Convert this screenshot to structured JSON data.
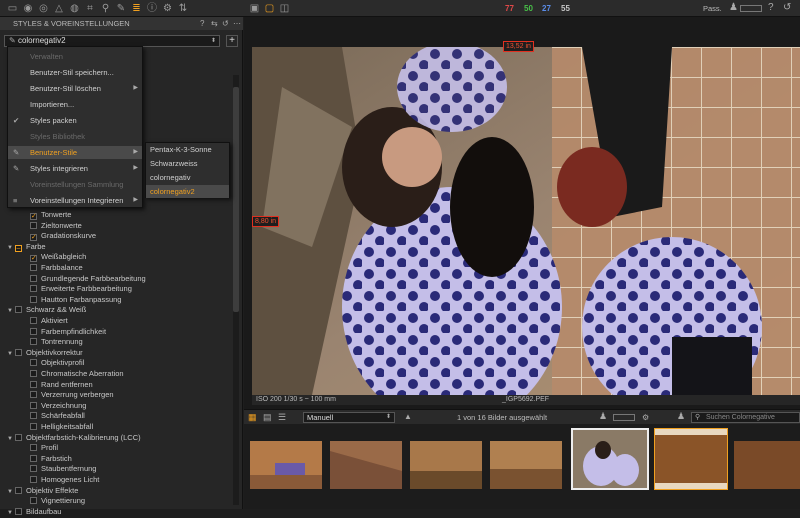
{
  "toolbar": {
    "icons": [
      "library-icon",
      "camera-icon",
      "color-icon",
      "exposure-icon",
      "lens-icon",
      "crop-icon",
      "search-icon",
      "brush-icon",
      "styles-icon",
      "info-icon",
      "gear-icon",
      "adjust-icon"
    ],
    "counts": [
      {
        "value": "77",
        "color": "#e04848"
      },
      {
        "value": "50",
        "color": "#48c048"
      },
      {
        "value": "27",
        "color": "#5a8ce8"
      },
      {
        "value": "55",
        "color": "#c8c8c8"
      }
    ],
    "pass_label": "Pass."
  },
  "panel": {
    "title": "STYLES & VOREINSTELLUNGEN",
    "selected_style": "colornegativ2",
    "add_label": "+"
  },
  "menu": {
    "items": [
      {
        "label": "Verwalten",
        "type": "header"
      },
      {
        "label": "Benutzer-Stil speichern...",
        "type": "item"
      },
      {
        "label": "Benutzer-Stil löschen",
        "type": "submenu"
      },
      {
        "label": "Importieren...",
        "type": "item"
      },
      {
        "label": "Styles packen",
        "type": "check"
      },
      {
        "label": "Styles Bibliothek",
        "type": "header"
      },
      {
        "label": "Benutzer-Stile",
        "type": "submenu-active"
      },
      {
        "label": "Styles integrieren",
        "type": "submenu"
      },
      {
        "label": "Voreinstellungen Sammlung",
        "type": "header"
      },
      {
        "label": "Voreinstellungen Integrieren",
        "type": "submenu"
      }
    ]
  },
  "submenu": {
    "items": [
      "Pentax-K-3-Sonne",
      "Schwarzweiss",
      "colornegativ",
      "colornegativ2"
    ],
    "selected": "colornegativ2"
  },
  "tree": [
    {
      "label": "Tonwerte",
      "level": 2,
      "checked": true
    },
    {
      "label": "Zieltonwerte",
      "level": 2,
      "checked": false
    },
    {
      "label": "Gradationskurve",
      "level": 2,
      "checked": true
    },
    {
      "label": "Farbe",
      "level": 1,
      "checked": false,
      "group": true
    },
    {
      "label": "Weißabgleich",
      "level": 2,
      "checked": true
    },
    {
      "label": "Farbbalance",
      "level": 2,
      "checked": false
    },
    {
      "label": "Grundlegende Farbbearbeitung",
      "level": 2,
      "checked": false
    },
    {
      "label": "Erweiterte Farbbearbeitung",
      "level": 2,
      "checked": false
    },
    {
      "label": "Hautton Farbanpassung",
      "level": 2,
      "checked": false
    },
    {
      "label": "Schwarz && Weiß",
      "level": 1,
      "checked": false,
      "group": true
    },
    {
      "label": "Aktiviert",
      "level": 2,
      "checked": false
    },
    {
      "label": "Farbempfindlichkeit",
      "level": 2,
      "checked": false
    },
    {
      "label": "Tontrennung",
      "level": 2,
      "checked": false
    },
    {
      "label": "Objektivkorrektur",
      "level": 1,
      "checked": false,
      "group": true
    },
    {
      "label": "Objektivprofil",
      "level": 2,
      "checked": false
    },
    {
      "label": "Chromatische Aberration",
      "level": 2,
      "checked": false
    },
    {
      "label": "Rand entfernen",
      "level": 2,
      "checked": false
    },
    {
      "label": "Verzerrung verbergen",
      "level": 2,
      "checked": false
    },
    {
      "label": "Verzeichnung",
      "level": 2,
      "checked": false
    },
    {
      "label": "Schärfeabfall",
      "level": 2,
      "checked": false
    },
    {
      "label": "Helligkeitsabfall",
      "level": 2,
      "checked": false
    },
    {
      "label": "Objektfarbstich-Kalibrierung (LCC)",
      "level": 1,
      "checked": false,
      "group": true
    },
    {
      "label": "Profil",
      "level": 2,
      "checked": false
    },
    {
      "label": "Farbstich",
      "level": 2,
      "checked": false
    },
    {
      "label": "Staubentfernung",
      "level": 2,
      "checked": false
    },
    {
      "label": "Homogenes Licht",
      "level": 2,
      "checked": false
    },
    {
      "label": "Objektiv Effekte",
      "level": 1,
      "checked": false,
      "group": true
    },
    {
      "label": "Vignettierung",
      "level": 2,
      "checked": false
    },
    {
      "label": "Bildaufbau",
      "level": 1,
      "checked": false,
      "group": true
    }
  ],
  "viewer": {
    "width_label": "13,52 in",
    "height_label": "8,80 in",
    "exif": "ISO 200   1/30 s ~ 100 mm",
    "filename": "_IGP5692.PEF"
  },
  "browser": {
    "sort": "Manuell",
    "count_text": "1 von 16 Bilder ausgewählt",
    "search_placeholder": "Suchen Colornegative"
  }
}
